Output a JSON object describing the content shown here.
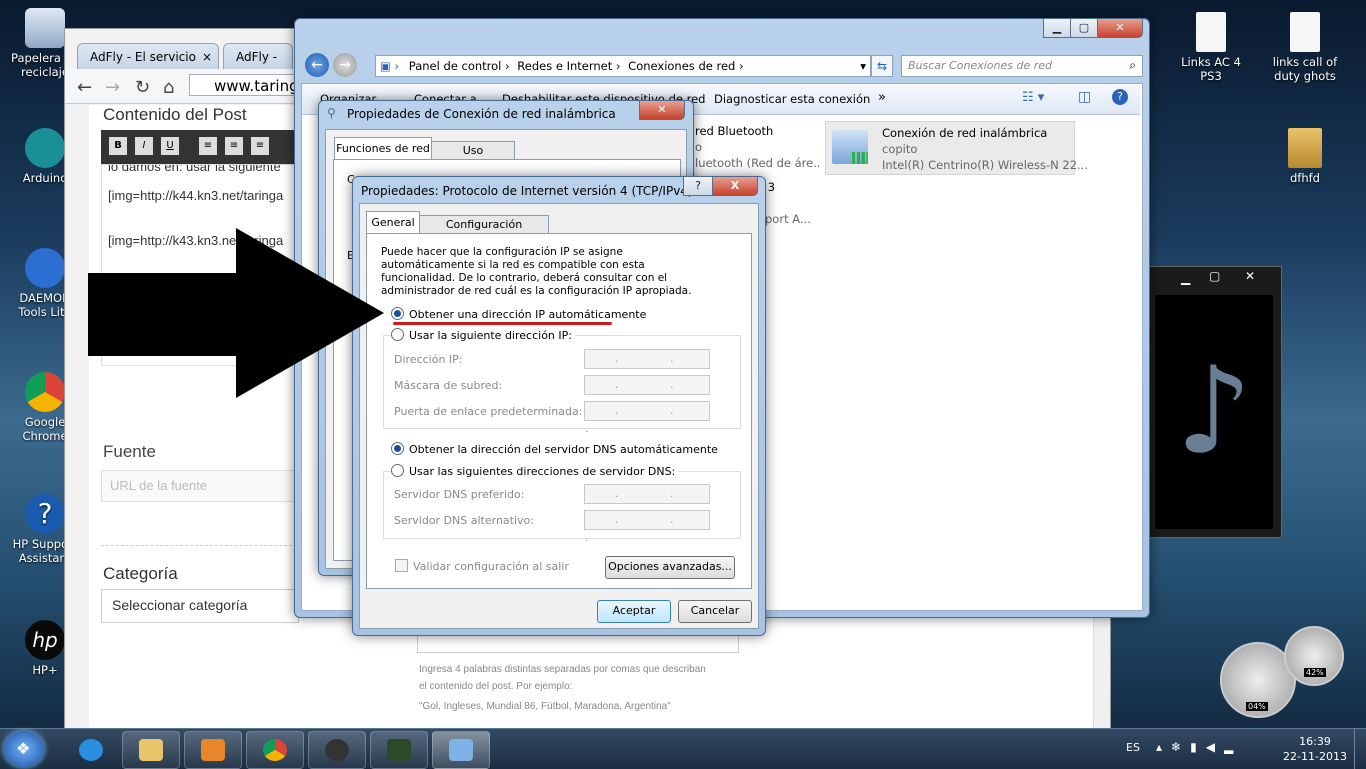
{
  "desktop": {
    "icons_left": [
      {
        "label": "Papelera de reciclaje"
      },
      {
        "label": "Arduino"
      },
      {
        "label": "DAEMON Tools Lite"
      },
      {
        "label": "Google Chrome"
      },
      {
        "label": "HP Support Assistant"
      },
      {
        "label": "HP+"
      }
    ],
    "icons_right": [
      {
        "label": "Links AC 4 PS3"
      },
      {
        "label": "links call of duty ghots"
      },
      {
        "label": "dfhfd"
      }
    ]
  },
  "browser": {
    "tabs": [
      {
        "label": "AdFly - El servicio"
      },
      {
        "label": "AdFly -"
      }
    ],
    "url": "www.taring",
    "post": {
      "content_heading": "Contenido del Post",
      "toolbar": [
        "B",
        "I",
        "U"
      ],
      "snippet_top": "lo damos en: usar la siguiente",
      "line1": "[img=http://k44.kn3.net/taringa",
      "line2": "[img=http://k43.kn3.net/taringa",
      "fuente_heading": "Fuente",
      "fuente_placeholder": "URL de la fuente",
      "categoria_heading": "Categoría",
      "categoria_select": "Seleccionar categoría",
      "tags_help1": "Ingresa 4 palabras distintas separadas por comas que describan",
      "tags_help2": "el contenido del post. Por ejemplo:",
      "tags_example": "\"Gol, Ingleses, Mundial 86, Fútbol, Maradona, Argentina\""
    }
  },
  "explorer": {
    "breadcrumb": [
      "Panel de control",
      "Redes e Internet",
      "Conexiones de red"
    ],
    "search_placeholder": "Buscar Conexiones de red",
    "toolbar": {
      "organizar": "Organizar",
      "conectar": "Conectar a",
      "deshabilitar": "Deshabilitar este dispositivo de red",
      "diagnosticar": "Diagnosticar esta conexión",
      "more": "»"
    },
    "connections": [
      {
        "name": "red Bluetooth",
        "status": "o",
        "device": "luetooth (Red de áre..."
      },
      {
        "name": "Conexión de red inalámbrica",
        "status": "copito",
        "device": "Intel(R) Centrino(R) Wireless-N 22..."
      }
    ],
    "partial_row": "a 3",
    "partial_row2": "port A..."
  },
  "wireless_props": {
    "title": "Propiedades de Conexión de red inalámbrica",
    "tabs": [
      "Funciones de red",
      "Uso compartido"
    ],
    "partial_text": "C",
    "partial_text2": "E"
  },
  "ipv4": {
    "title": "Propiedades: Protocolo de Internet versión 4 (TCP/IPv4)",
    "help_btn": "?",
    "close_btn": "X",
    "tabs": [
      "General",
      "Configuración alternativa"
    ],
    "description": "Puede hacer que la configuración IP se asigne automáticamente si la red es compatible con esta funcionalidad. De lo contrario, deberá consultar con el administrador de red cuál es la configuración IP apropiada.",
    "radio_auto_ip": "Obtener una dirección IP automáticamente",
    "radio_static_ip": "Usar la siguiente dirección IP:",
    "ip_label": "Dirección IP:",
    "mask_label": "Máscara de subred:",
    "gateway_label": "Puerta de enlace predeterminada:",
    "radio_auto_dns": "Obtener la dirección del servidor DNS automáticamente",
    "radio_static_dns": "Usar las siguientes direcciones de servidor DNS:",
    "dns_pref_label": "Servidor DNS preferido:",
    "dns_alt_label": "Servidor DNS alternativo:",
    "ip_placeholder": ". . .",
    "validate_label": "Validar configuración al salir",
    "advanced_btn": "Opciones avanzadas...",
    "ok_btn": "Aceptar",
    "cancel_btn": "Cancelar"
  },
  "gauges": {
    "cpu": "04%",
    "mem": "42%"
  },
  "taskbar": {
    "lang": "ES",
    "time": "16:39",
    "date": "22-11-2013"
  },
  "colors": {
    "accent_red": "#cc1a1a",
    "arrow": "#000000"
  }
}
